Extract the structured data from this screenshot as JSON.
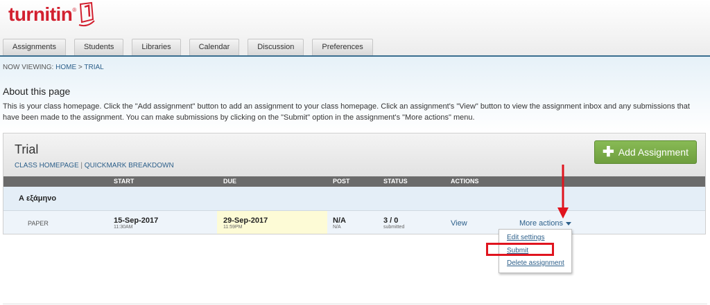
{
  "brand": {
    "logo_text": "turnitin",
    "reg_mark": "®",
    "color": "#d2202f"
  },
  "tabs": [
    {
      "label": "Assignments"
    },
    {
      "label": "Students"
    },
    {
      "label": "Libraries"
    },
    {
      "label": "Calendar"
    },
    {
      "label": "Discussion"
    },
    {
      "label": "Preferences"
    }
  ],
  "breadcrumb": {
    "prefix": "NOW VIEWING:",
    "home": "HOME",
    "separator": ">",
    "current": "TRIAL"
  },
  "about": {
    "title": "About this page",
    "text": "This is your class homepage. Click the \"Add assignment\" button to add an assignment to your class homepage. Click an assignment's \"View\" button to view the assignment inbox and any submissions that have been made to the assignment. You can make submissions by clicking on the \"Submit\" option in the assignment's \"More actions\" menu."
  },
  "class": {
    "title": "Trial",
    "link_homepage": "CLASS HOMEPAGE",
    "link_separator": "|",
    "link_quickmark": "QUICKMARK BREAKDOWN",
    "add_button_label": "Add Assignment",
    "add_button_icon": "plus-icon"
  },
  "table": {
    "columns": {
      "start": "START",
      "due": "DUE",
      "post": "POST",
      "status": "STATUS",
      "actions": "ACTIONS"
    },
    "section_name": "Α εξάμηνο",
    "row": {
      "type": "PAPER",
      "start_date": "15-Sep-2017",
      "start_time": "11:30AM",
      "due_date": "29-Sep-2017",
      "due_time": "11:59PM",
      "post_main": "N/A",
      "post_sub": "N/A",
      "status_main": "3 / 0",
      "status_sub": "submitted",
      "view_label": "View",
      "more_label": "More actions"
    }
  },
  "menu": {
    "items": [
      {
        "label": "Edit settings"
      },
      {
        "label": "Submit"
      },
      {
        "label": "Delete assignment"
      }
    ]
  },
  "colors": {
    "accent_green": "#7aab48",
    "link_blue": "#2c5f8a",
    "annotation_red": "#e0141e"
  }
}
